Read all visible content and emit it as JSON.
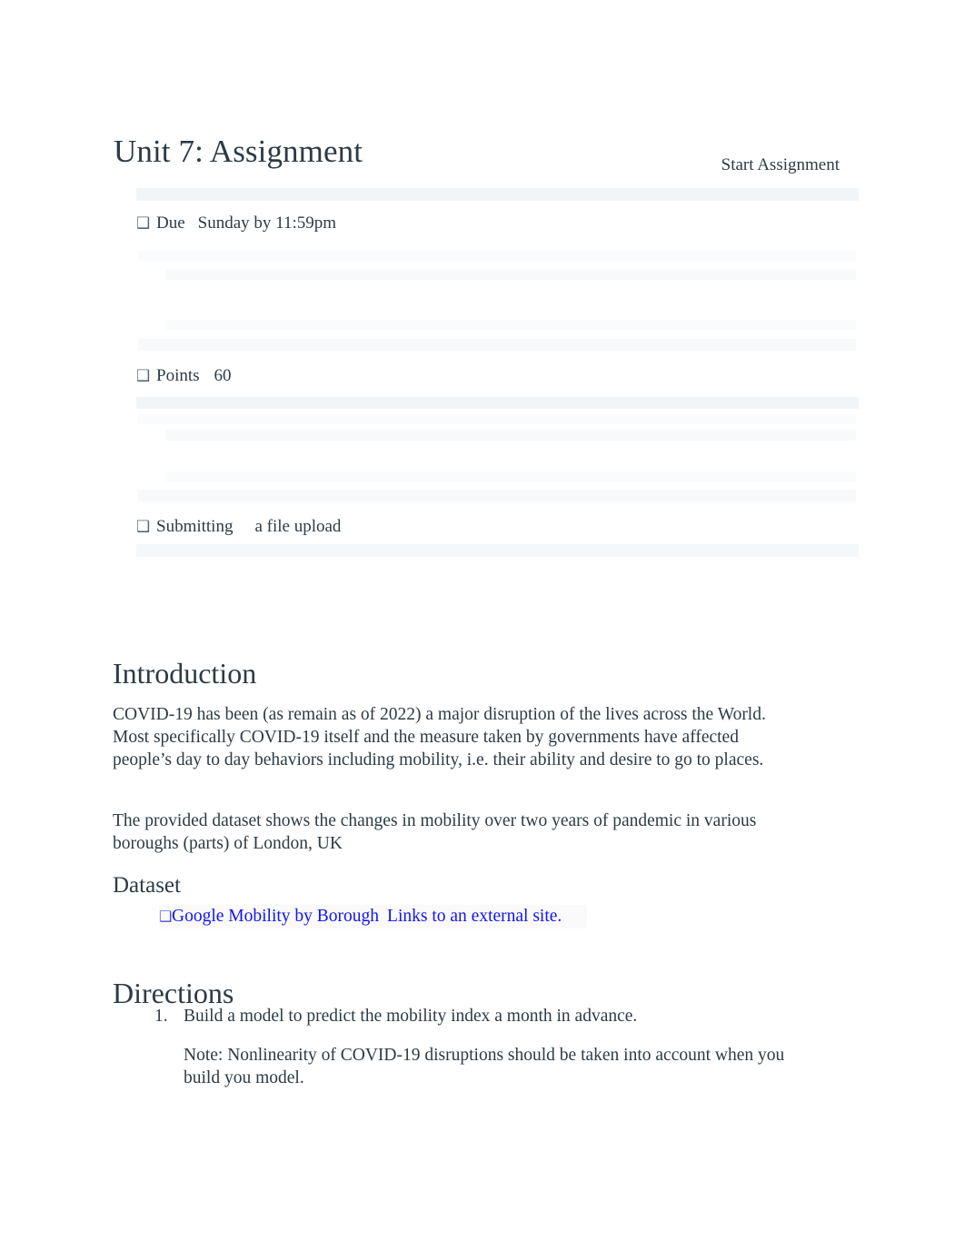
{
  "page": {
    "title": "Unit 7: Assignment",
    "start_assignment_label": "Start Assignment"
  },
  "metadata": {
    "glyph": "❑",
    "rows": [
      {
        "label": "Due",
        "value": "Sunday by 11:59pm"
      },
      {
        "label": "Points",
        "value": "60"
      },
      {
        "label": "Submitting",
        "value": "a file upload"
      }
    ]
  },
  "introduction": {
    "heading": "Introduction",
    "paragraph_1": "COVID-19 has been (as remain as of 2022) a major disruption of the lives across the World. Most specifically COVID-19 itself and the measure taken by governments have affected people’s day to day behaviors including mobility, i.e. their ability and desire to go to places.",
    "paragraph_2": "The provided dataset shows the changes in mobility over two years of pandemic in various boroughs (parts) of London, UK"
  },
  "dataset": {
    "heading": "Dataset",
    "link_glyph": "❑",
    "link_text": "Google Mobility by Borough",
    "link_note": "Links to an external site."
  },
  "directions": {
    "heading": "Directions",
    "items": [
      {
        "marker": "1.",
        "text": "Build a model to predict the mobility index a month in advance.",
        "note": "Note: Nonlinearity of COVID-19 disruptions should be taken into account when you build you model."
      }
    ]
  },
  "colors": {
    "text": "#2d3b45",
    "link": "#1414ef",
    "faint_bar": "#f7f9fa",
    "background": "#ffffff"
  }
}
